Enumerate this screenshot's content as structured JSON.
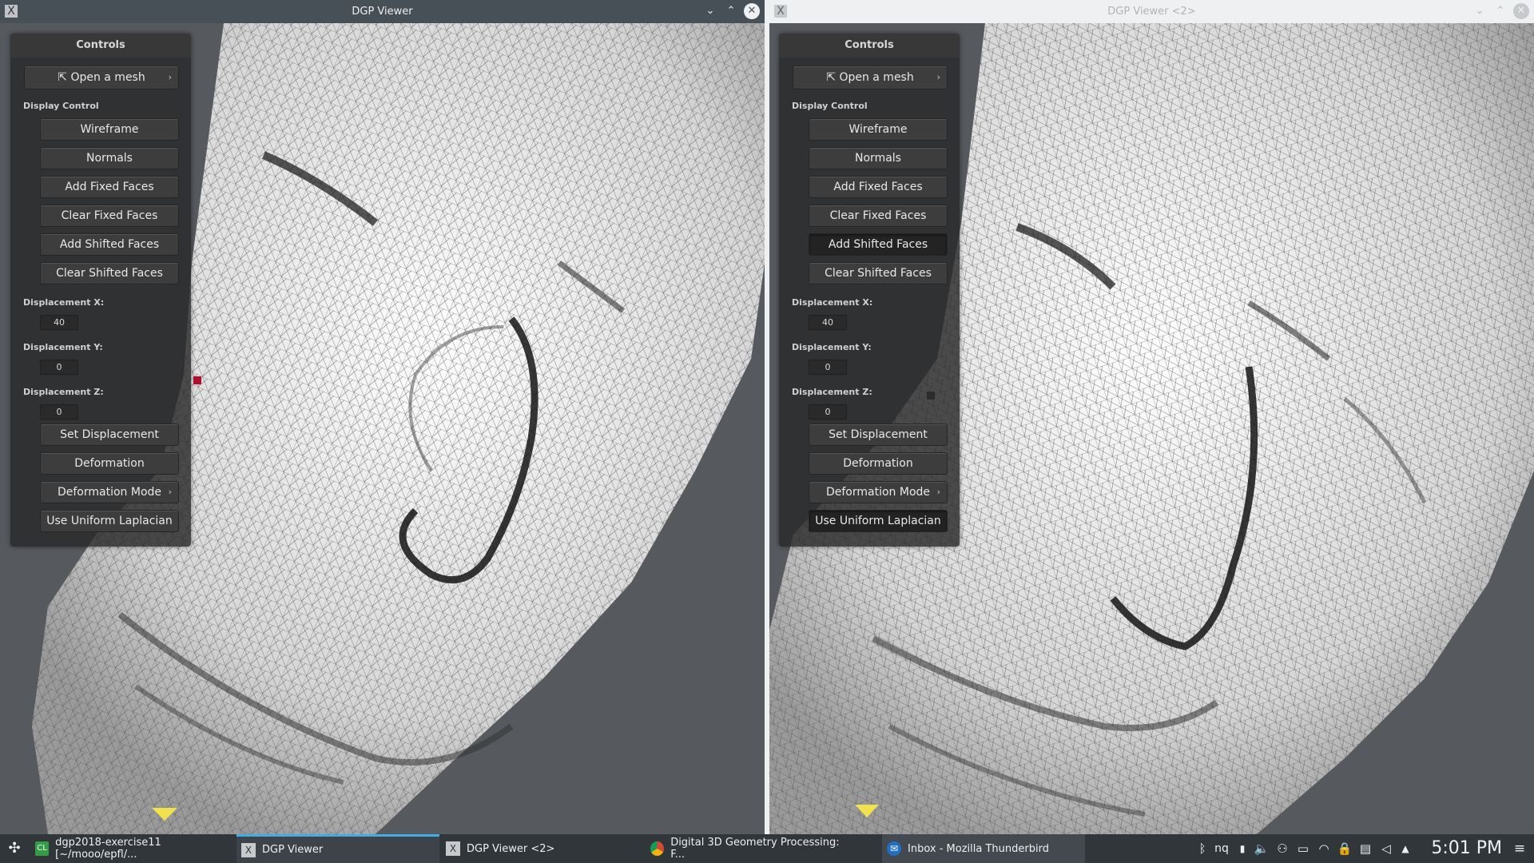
{
  "windows": [
    {
      "title": "DGP Viewer",
      "app_icon": "X",
      "controls": {
        "header": "Controls",
        "open_mesh_label": "Open a mesh",
        "display_control_label": "Display Control",
        "wireframe_label": "Wireframe",
        "normals_label": "Normals",
        "add_fixed_label": "Add Fixed Faces",
        "clear_fixed_label": "Clear Fixed Faces",
        "add_shifted_label": "Add Shifted Faces",
        "clear_shifted_label": "Clear Shifted Faces",
        "disp_x_label": "Displacement X:",
        "disp_x_value": "40",
        "disp_y_label": "Displacement Y:",
        "disp_y_value": "0",
        "disp_z_label": "Displacement Z:",
        "disp_z_value": "0",
        "set_displacement_label": "Set Displacement",
        "deformation_label": "Deformation",
        "deformation_mode_label": "Deformation Mode",
        "uniform_laplacian_label": "Use Uniform Laplacian"
      }
    },
    {
      "title": "DGP Viewer <2>",
      "app_icon": "X",
      "controls": {
        "header": "Controls",
        "open_mesh_label": "Open a mesh",
        "display_control_label": "Display Control",
        "wireframe_label": "Wireframe",
        "normals_label": "Normals",
        "add_fixed_label": "Add Fixed Faces",
        "clear_fixed_label": "Clear Fixed Faces",
        "add_shifted_label": "Add Shifted Faces",
        "clear_shifted_label": "Clear Shifted Faces",
        "disp_x_label": "Displacement X:",
        "disp_x_value": "40",
        "disp_y_label": "Displacement Y:",
        "disp_y_value": "0",
        "disp_z_label": "Displacement Z:",
        "disp_z_value": "0",
        "set_displacement_label": "Set Displacement",
        "deformation_label": "Deformation",
        "deformation_mode_label": "Deformation Mode",
        "uniform_laplacian_label": "Use Uniform Laplacian"
      }
    }
  ],
  "taskbar": {
    "tasks": [
      {
        "label": "dgp2018-exercise11 [~/mooo/epfl/..."
      },
      {
        "label": "DGP Viewer"
      },
      {
        "label": "DGP Viewer <2>"
      },
      {
        "label": "Digital 3D Geometry Processing: F..."
      },
      {
        "label": "Inbox - Mozilla Thunderbird"
      }
    ],
    "keyboard_layout": "nq",
    "clock": "5:01 PM"
  },
  "colors": {
    "titlebar_active": "#475057",
    "titlebar_inactive": "#eff0f1",
    "viewport_bg": "#56595e",
    "panel_bg": "#282828",
    "taskbar_bg": "#31363b",
    "task_accent": "#3daee9",
    "fixed_marker": "#b0102d",
    "handle_marker": "#f2e24a"
  }
}
